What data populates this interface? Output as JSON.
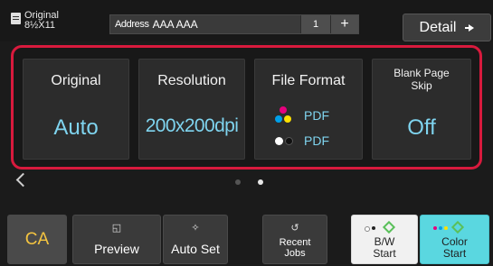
{
  "header": {
    "original_label": "Original",
    "original_size": "8½X11",
    "address_label": "Address",
    "address_value": "AAA AAA",
    "address_count": "1",
    "add_symbol": "+",
    "detail_label": "Detail"
  },
  "settings": {
    "original": {
      "title": "Original",
      "value": "Auto"
    },
    "resolution": {
      "title": "Resolution",
      "value": "200x200dpi"
    },
    "file_format": {
      "title": "File Format",
      "color_value": "PDF",
      "bw_value": "PDF"
    },
    "blank_page_skip": {
      "title_line1": "Blank Page",
      "title_line2": "Skip",
      "value": "Off"
    }
  },
  "pager": {
    "current_page": 2,
    "total_pages": 2
  },
  "footer": {
    "ca_label": "CA",
    "preview_label": "Preview",
    "auto_set_label": "Auto Set",
    "recent_jobs_line1": "Recent",
    "recent_jobs_line2": "Jobs",
    "bw_start_line1": "B/W",
    "bw_start_line2": "Start",
    "color_start_line1": "Color",
    "color_start_line2": "Start"
  },
  "colors": {
    "selection_frame": "#d81a3d",
    "value_text": "#7fd4ef",
    "ca_text": "#f4c440",
    "color_start_bg": "#5ad7e0",
    "bw_start_bg": "#f1f1f1"
  },
  "icons": [
    "document-icon",
    "arrow-right-icon",
    "color-dots-icon",
    "bw-dots-icon",
    "chevron-left-icon",
    "preview-icon",
    "auto-set-icon",
    "recent-jobs-icon",
    "start-diamond-icon"
  ]
}
